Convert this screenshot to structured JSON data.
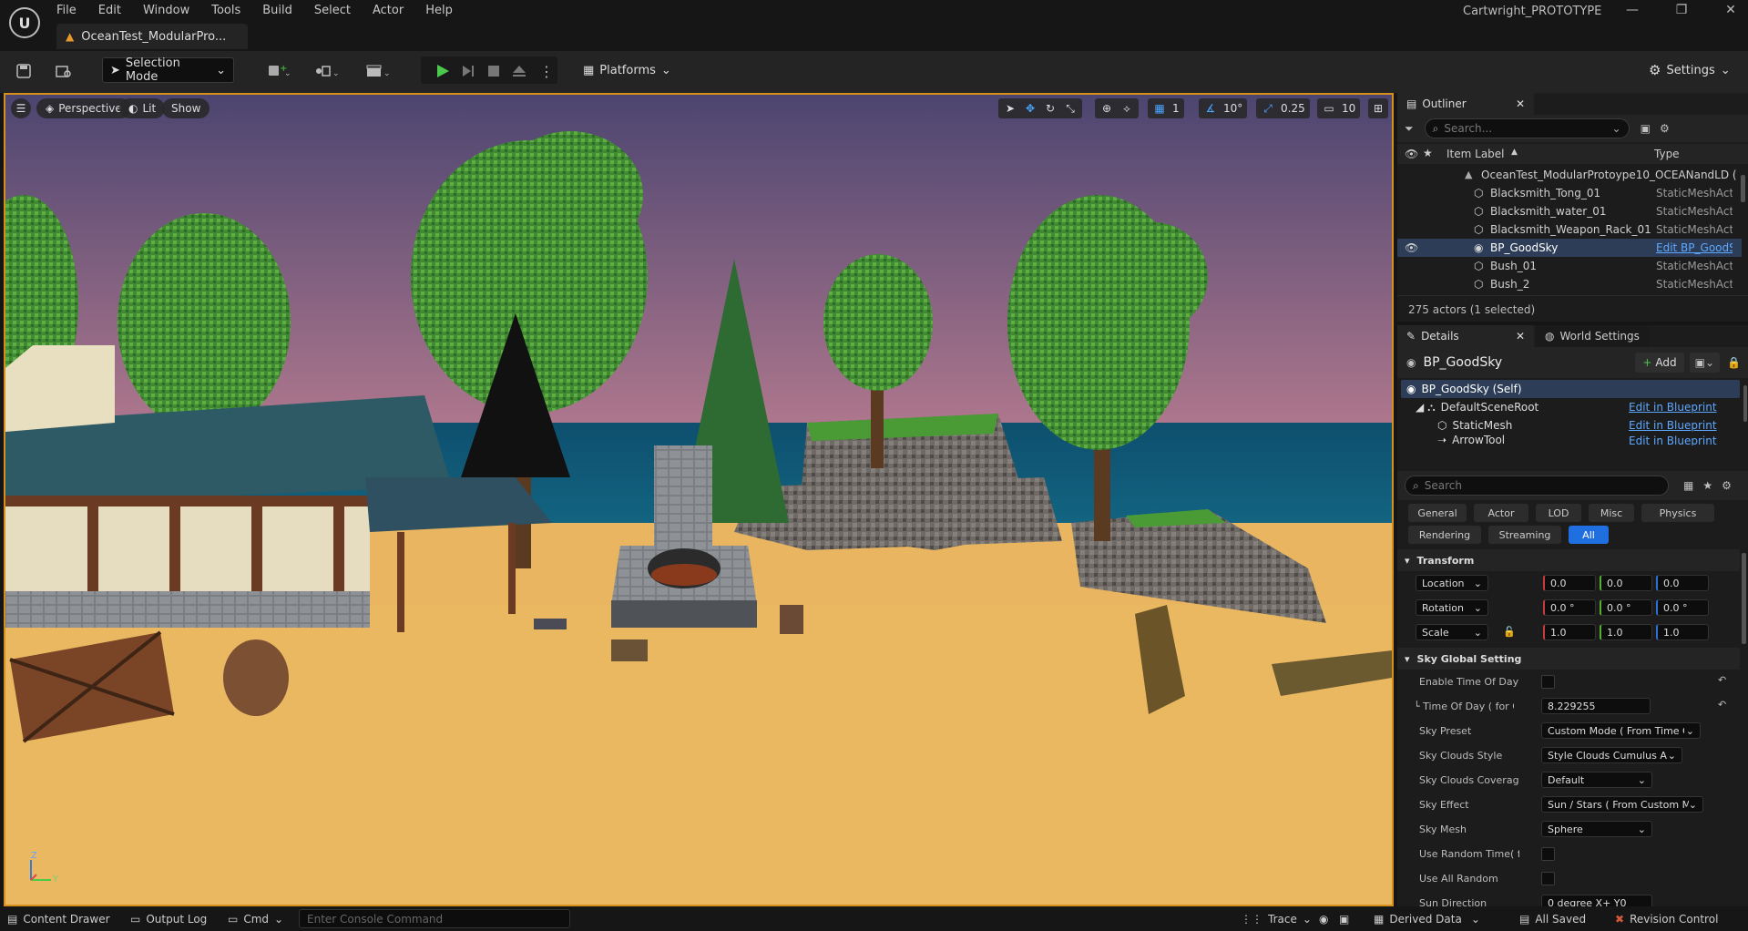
{
  "menu": [
    "File",
    "Edit",
    "Window",
    "Tools",
    "Build",
    "Select",
    "Actor",
    "Help"
  ],
  "doc_tab": "OceanTest_ModularPro...",
  "project_title": "Cartwright_PROTOTYPE",
  "toolbar": {
    "selection_mode": "Selection Mode",
    "platforms": "Platforms",
    "settings": "Settings"
  },
  "viewport": {
    "perspective": "Perspective",
    "lit": "Lit",
    "show": "Show",
    "grid_size": "1",
    "angle_snap": "10°",
    "scale_snap": "0.25",
    "camera_speed": "10",
    "axis_z": "Z",
    "axis_y": "Y"
  },
  "outliner": {
    "tab": "Outliner",
    "search_placeholder": "Search...",
    "col_label": "Item Label",
    "col_type": "Type",
    "root": "OceanTest_ModularProtoype10_OCEANandLD (",
    "rows": [
      {
        "label": "Blacksmith_Tong_01",
        "type": "StaticMeshAct"
      },
      {
        "label": "Blacksmith_water_01",
        "type": "StaticMeshAct"
      },
      {
        "label": "Blacksmith_Weapon_Rack_01",
        "type": "StaticMeshAct"
      },
      {
        "label": "BP_GoodSky",
        "type": "Edit BP_GoodS"
      },
      {
        "label": "Bush_01",
        "type": "StaticMeshAct"
      },
      {
        "label": "Bush_2",
        "type": "StaticMeshAct"
      }
    ],
    "summary": "275 actors (1 selected)"
  },
  "details": {
    "tab_details": "Details",
    "tab_world": "World Settings",
    "actor_name": "BP_GoodSky",
    "add": "Add",
    "components": [
      {
        "label": "BP_GoodSky (Self)",
        "link": ""
      },
      {
        "label": "DefaultSceneRoot",
        "link": "Edit in Blueprint"
      },
      {
        "label": "StaticMesh",
        "link": "Edit in Blueprint"
      },
      {
        "label": "ArrowTool",
        "link": "Edit in Blueprint"
      }
    ],
    "search_placeholder": "Search",
    "categories_row1": [
      "General",
      "Actor",
      "LOD",
      "Misc",
      "Physics"
    ],
    "categories_row2": [
      "Rendering",
      "Streaming",
      "All"
    ],
    "transform_header": "Transform",
    "location": {
      "label": "Location",
      "x": "0.0",
      "y": "0.0",
      "z": "0.0"
    },
    "rotation": {
      "label": "Rotation",
      "x": "0.0 °",
      "y": "0.0 °",
      "z": "0.0 °"
    },
    "scale": {
      "label": "Scale",
      "x": "1.0",
      "y": "1.0",
      "z": "1.0"
    },
    "sky_header": "Sky Global Setting",
    "props": {
      "enable_tod": "Enable Time Of Day",
      "tod_label": "└ Time Of Day ( for Cu...",
      "tod_value": "8.229255",
      "sky_preset": "Sky Preset",
      "sky_preset_value": "Custom Mode ( From Time C",
      "clouds_style": "Sky Clouds Style",
      "clouds_style_value": "Style Clouds Cumulus A",
      "clouds_coverage": "Sky Clouds Coverage...",
      "clouds_coverage_value": "Default",
      "sky_effect": "Sky Effect",
      "sky_effect_value": "Sun / Stars ( From Custom M",
      "sky_mesh": "Sky Mesh",
      "sky_mesh_value": "Sphere",
      "random_time": "Use Random Time( for...",
      "all_random": "Use All Random",
      "sun_direction": "Sun Direction",
      "sun_direction_value": "0 degree  X+ Y0"
    }
  },
  "statusbar": {
    "content_drawer": "Content Drawer",
    "output_log": "Output Log",
    "cmd": "Cmd",
    "console_placeholder": "Enter Console Command",
    "trace": "Trace",
    "derived_data": "Derived Data",
    "all_saved": "All Saved",
    "revision_control": "Revision Control"
  },
  "colors": {
    "accent": "#1f6fe0",
    "viewport_border": "#d6901a",
    "play_green": "#4cc94c"
  }
}
